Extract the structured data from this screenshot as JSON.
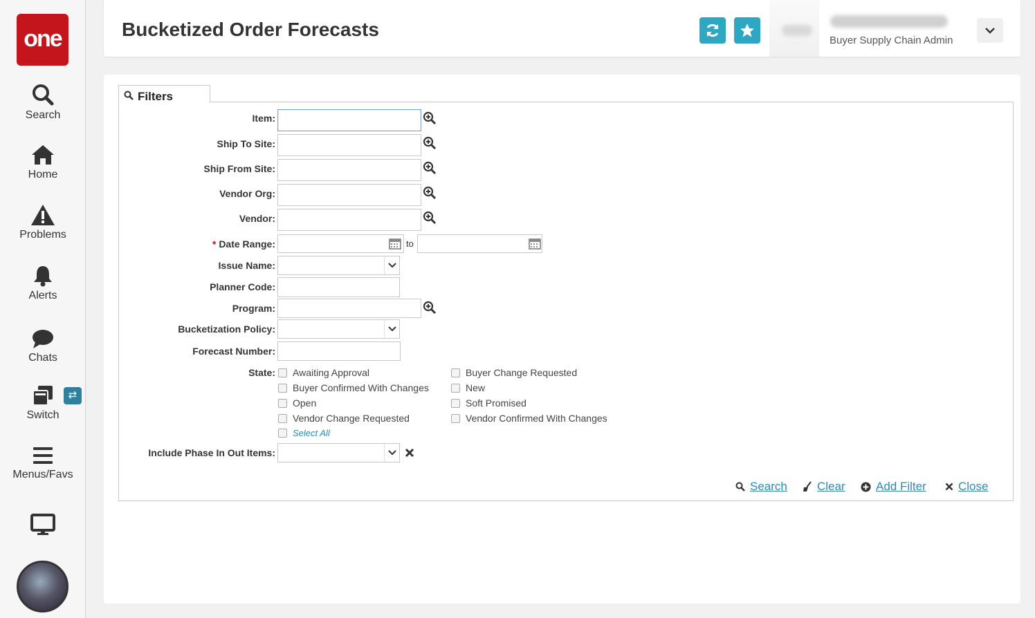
{
  "app": {
    "logo_text": "one"
  },
  "sidebar": {
    "items": [
      {
        "label": "Search",
        "icon": "search-icon"
      },
      {
        "label": "Home",
        "icon": "home-icon"
      },
      {
        "label": "Problems",
        "icon": "warning-icon"
      },
      {
        "label": "Alerts",
        "icon": "bell-icon"
      },
      {
        "label": "Chats",
        "icon": "chat-icon"
      },
      {
        "label": "Switch",
        "icon": "switch-icon"
      },
      {
        "label": "Menus/Favs",
        "icon": "menu-icon"
      }
    ],
    "switch_badge": "⇄"
  },
  "header": {
    "title": "Bucketized Order Forecasts",
    "user_role": "Buyer Supply Chain Admin"
  },
  "filters": {
    "tab_label": "Filters",
    "fields": {
      "item": "Item:",
      "ship_to_site": "Ship To Site:",
      "ship_from_site": "Ship From Site:",
      "vendor_org": "Vendor Org:",
      "vendor": "Vendor:",
      "date_range": "Date Range:",
      "date_required": "*",
      "date_to": "to",
      "issue_name": "Issue Name:",
      "planner_code": "Planner Code:",
      "program": "Program:",
      "bucketization_policy": "Bucketization Policy:",
      "forecast_number": "Forecast Number:",
      "state": "State:",
      "include_phase": "Include Phase In Out Items:"
    },
    "state_options_left": [
      "Awaiting Approval",
      "Buyer Confirmed With Changes",
      "Open",
      "Vendor Change Requested"
    ],
    "state_options_right": [
      "Buyer Change Requested",
      "New",
      "Soft Promised",
      "Vendor Confirmed With Changes"
    ],
    "select_all": "Select All"
  },
  "actions": {
    "search": "Search",
    "clear": "Clear",
    "add_filter": "Add Filter",
    "close": "Close"
  },
  "colors": {
    "brand": "#c4141c",
    "accent": "#2da7c2",
    "link": "#2d8bb5"
  }
}
